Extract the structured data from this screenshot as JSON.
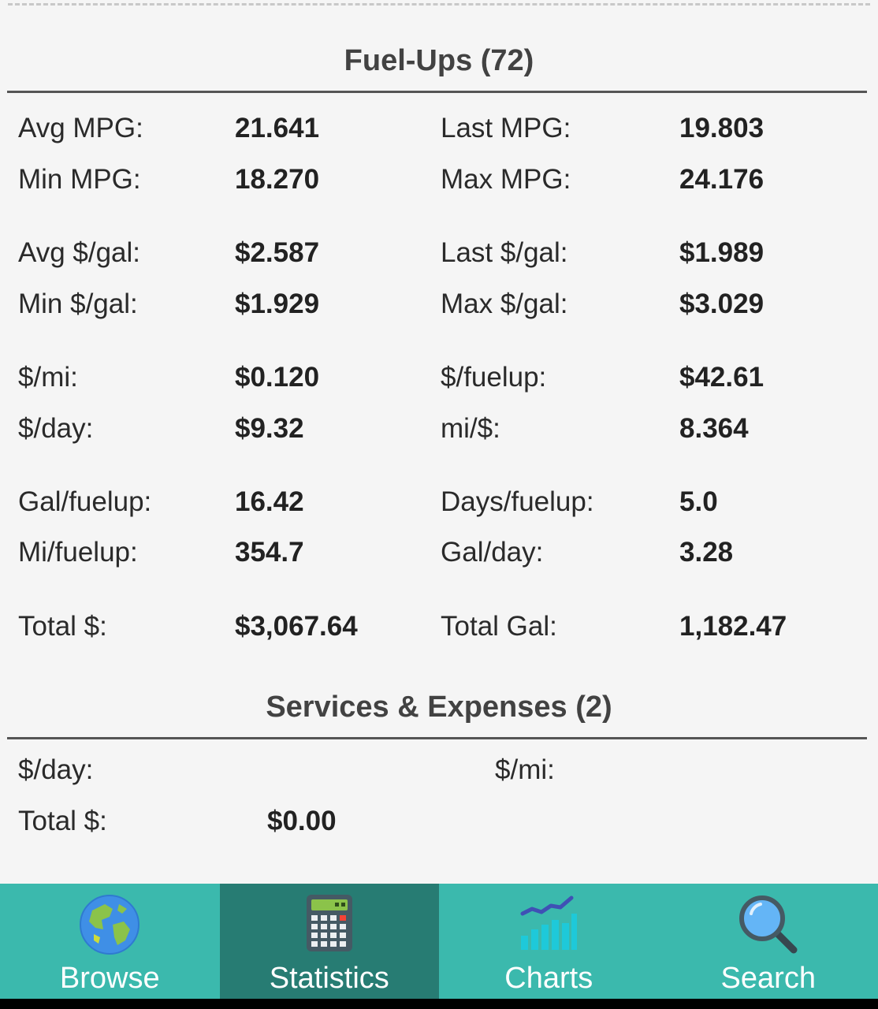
{
  "fuelups": {
    "title": "Fuel-Ups (72)",
    "rows": [
      {
        "l1": "Avg MPG:",
        "v1": "21.641",
        "l2": "Last MPG:",
        "v2": "19.803"
      },
      {
        "l1": "Min MPG:",
        "v1": "18.270",
        "l2": "Max MPG:",
        "v2": "24.176"
      },
      {
        "l1": "Avg $/gal:",
        "v1": "$2.587",
        "l2": "Last $/gal:",
        "v2": "$1.989"
      },
      {
        "l1": "Min $/gal:",
        "v1": "$1.929",
        "l2": "Max $/gal:",
        "v2": "$3.029"
      },
      {
        "l1": "$/mi:",
        "v1": "$0.120",
        "l2": "$/fuelup:",
        "v2": "$42.61"
      },
      {
        "l1": "$/day:",
        "v1": "$9.32",
        "l2": "mi/$:",
        "v2": "8.364"
      },
      {
        "l1": "Gal/fuelup:",
        "v1": "16.42",
        "l2": "Days/fuelup:",
        "v2": "5.0"
      },
      {
        "l1": "Mi/fuelup:",
        "v1": "354.7",
        "l2": "Gal/day:",
        "v2": "3.28"
      },
      {
        "l1": "Total $:",
        "v1": "$3,067.64",
        "l2": "Total Gal:",
        "v2": "1,182.47"
      }
    ]
  },
  "services": {
    "title": "Services & Expenses (2)",
    "per_day_label": "$/day:",
    "per_mi_label": "$/mi:",
    "total_label": "Total $:",
    "total_value": "$0.00"
  },
  "nav": {
    "items": [
      {
        "label": "Browse",
        "icon": "globe-icon"
      },
      {
        "label": "Statistics",
        "icon": "calculator-icon",
        "active": true
      },
      {
        "label": "Charts",
        "icon": "chart-icon"
      },
      {
        "label": "Search",
        "icon": "magnifier-icon"
      }
    ]
  },
  "colors": {
    "nav_bg": "#3bb9ad",
    "nav_active_bg": "#277c73"
  }
}
